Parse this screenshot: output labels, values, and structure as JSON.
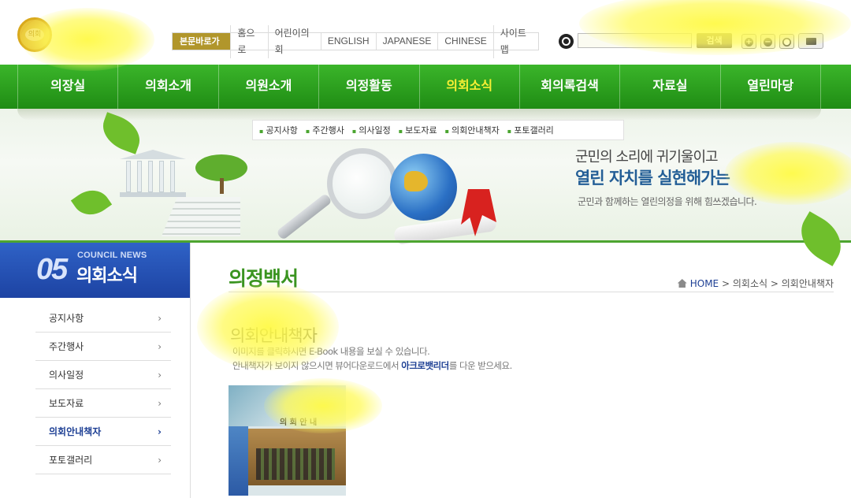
{
  "header": {
    "logo_text": "의회",
    "skip_link": "본문바로가기",
    "util_links": [
      "홈으로",
      "어린이의회",
      "ENGLISH",
      "JAPANESE",
      "CHINESE",
      "사이트맵"
    ],
    "search": {
      "placeholder": "",
      "button_label": "검색"
    },
    "controls": [
      "+",
      "−",
      "●"
    ]
  },
  "gnb": {
    "items": [
      "의장실",
      "의회소개",
      "의원소개",
      "의정활동",
      "의회소식",
      "회의록검색",
      "자료실",
      "열린마당"
    ],
    "active": "의회소식"
  },
  "submenu": [
    "공지사항",
    "주간행사",
    "의사일정",
    "보도자료",
    "의회안내책자",
    "포토갤러리"
  ],
  "banner": {
    "line1": "군민의 소리에 귀기울이고",
    "line2": "열린 자치를 실현해가는",
    "line3": "군민과 함께하는 열린의정을 위해 힘쓰겠습니다."
  },
  "sidebar": {
    "number": "05",
    "title_en": "COUNCIL NEWS",
    "title_ko": "의회소식",
    "items": [
      "공지사항",
      "주간행사",
      "의사일정",
      "보도자료",
      "의회안내책자",
      "포토갤러리"
    ],
    "active_index": 4,
    "chevron": "›"
  },
  "content": {
    "page_title": "의정백서",
    "breadcrumb": {
      "home": "HOME",
      "level1": "의회소식",
      "level2": "의회안내책자",
      "separator": ">"
    },
    "heading": "의회안내책자",
    "desc1": "이미지를 클릭하시면 E-Book 내용을 보실 수 있습니다.",
    "desc2_before": "안내책자가 보이지 않으시면 뷰어다운로드에서 ",
    "desc2_link": "아크로뱃리더",
    "desc2_after": "를 다운 받으세요.",
    "book_title": "의 회 안 내"
  },
  "colors": {
    "nav_green": "#2aa01e",
    "active_nav_text": "#f7ef34",
    "sidebar_blue": "#2a56bb",
    "title_green": "#3a9420",
    "link_blue": "#1d3f94"
  }
}
